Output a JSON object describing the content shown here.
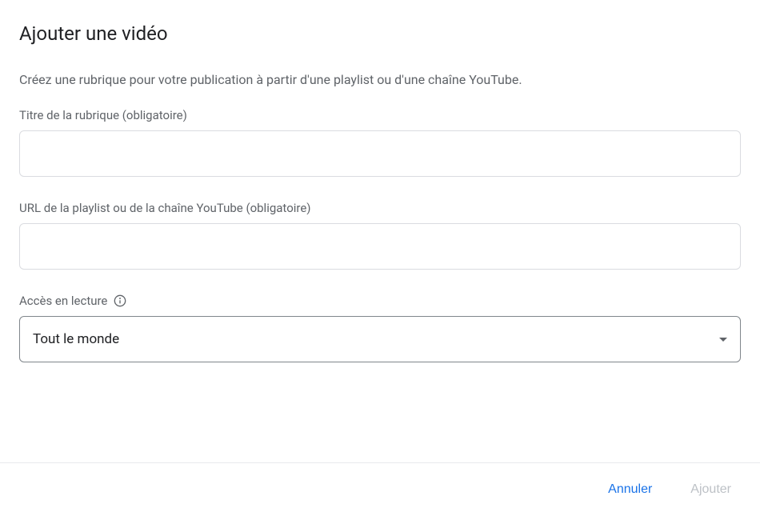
{
  "dialog": {
    "title": "Ajouter une vidéo",
    "description": "Créez une rubrique pour votre publication à partir d'une playlist ou d'une chaîne YouTube."
  },
  "fields": {
    "titleLabel": "Titre de la rubrique (obligatoire)",
    "urlLabel": "URL de la playlist ou de la chaîne YouTube (obligatoire)",
    "accessLabel": "Accès en lecture",
    "accessValue": "Tout le monde"
  },
  "actions": {
    "cancel": "Annuler",
    "add": "Ajouter"
  }
}
